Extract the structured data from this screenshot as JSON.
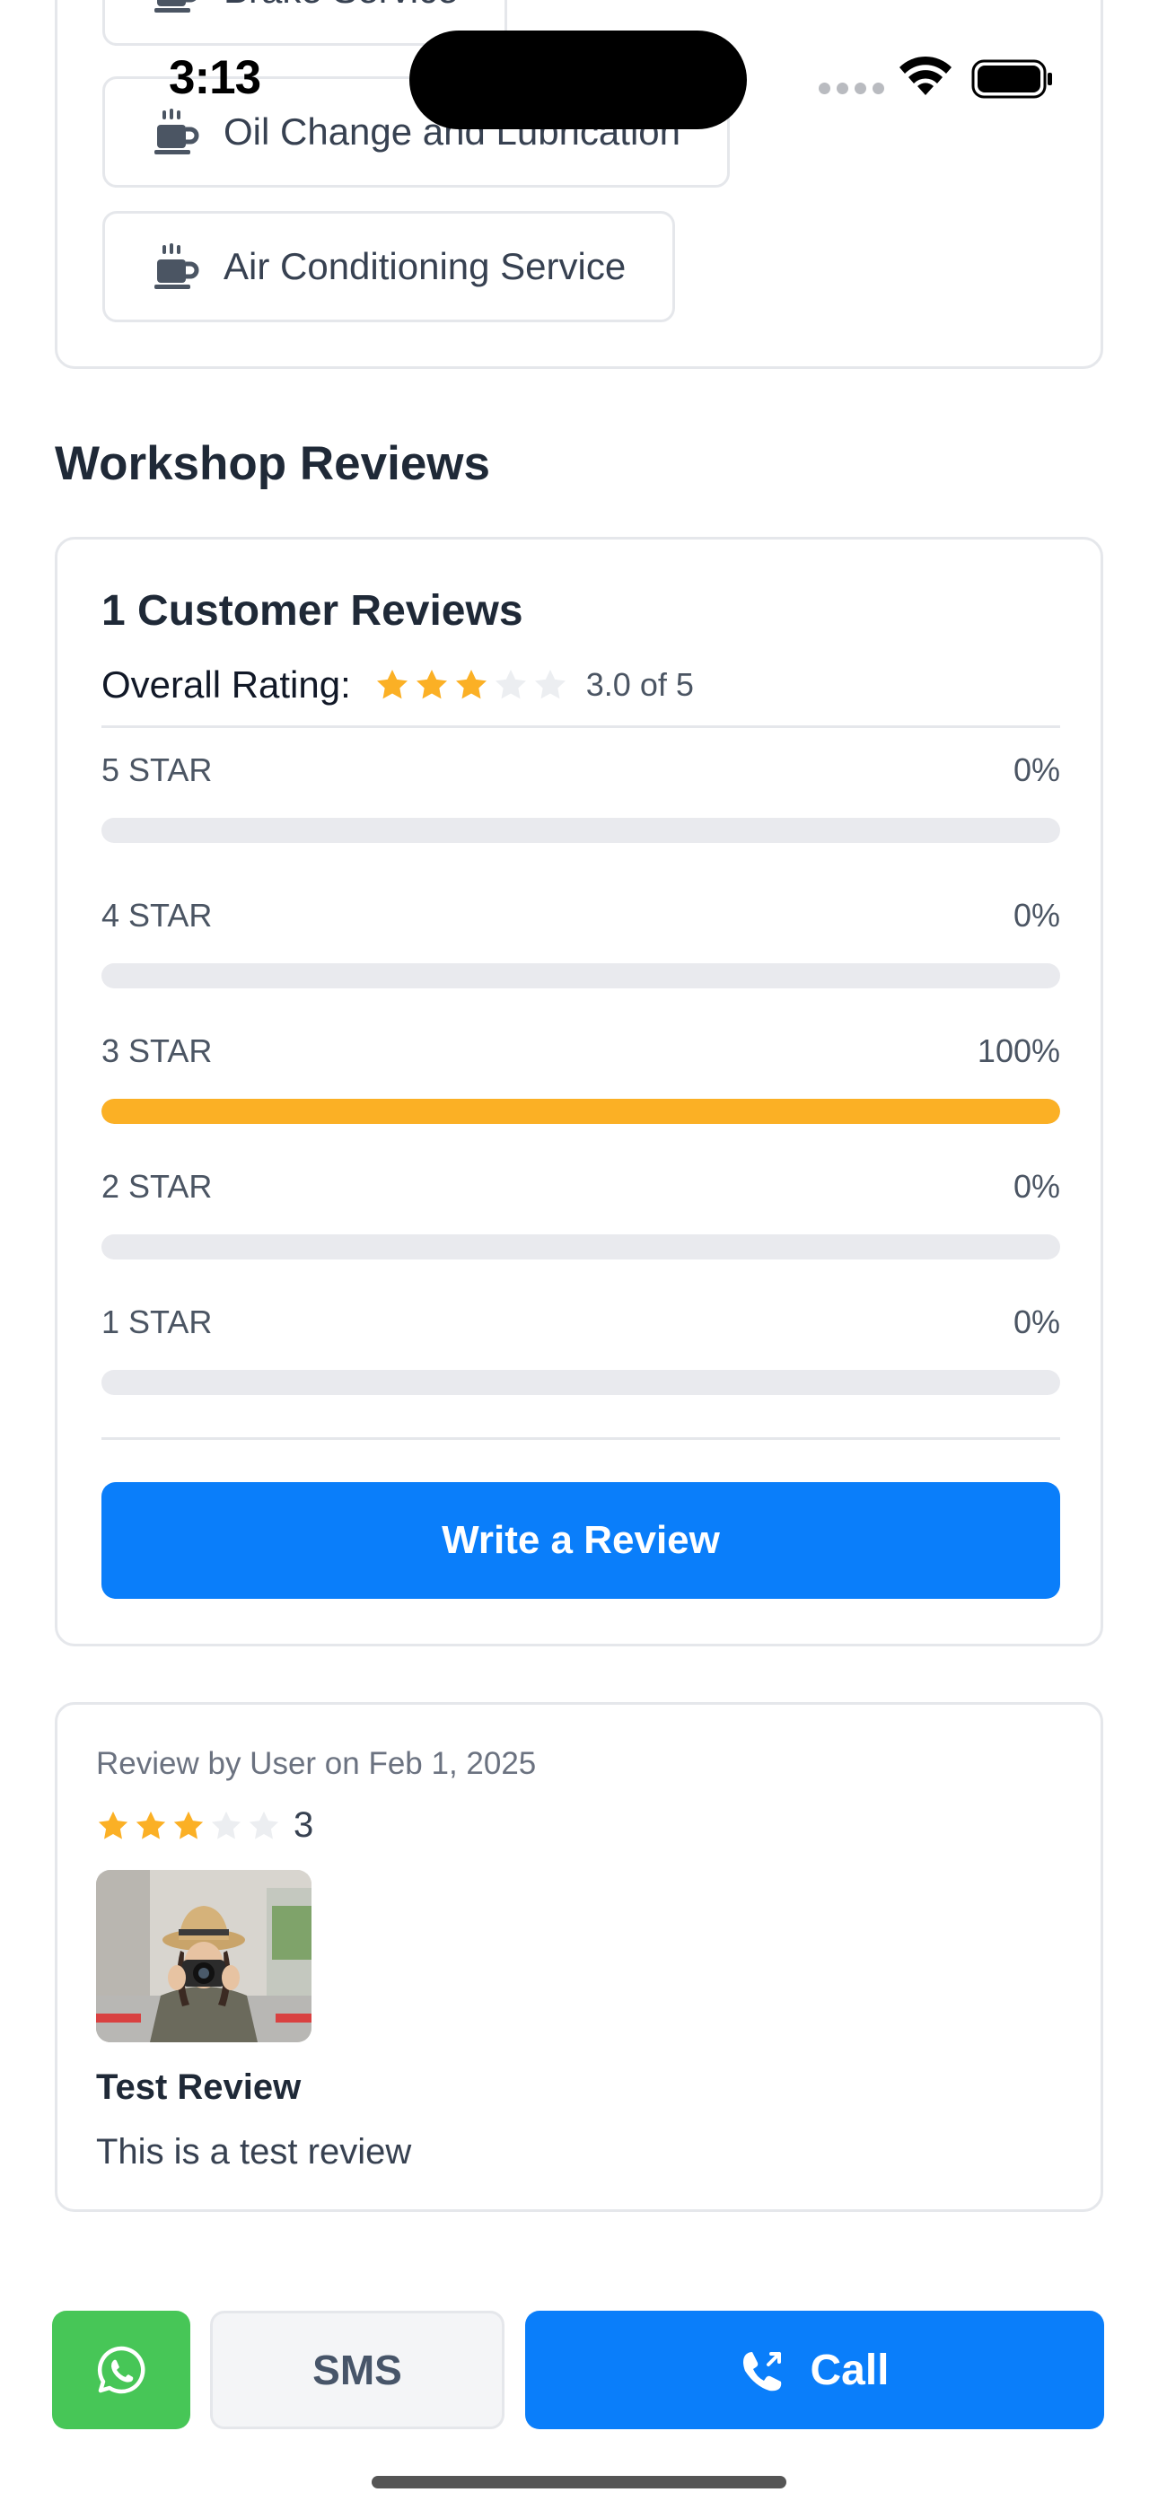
{
  "status_bar": {
    "time": "3:13"
  },
  "services": {
    "items": [
      {
        "label": "Brake Service",
        "icon": "coffee-cup-icon"
      },
      {
        "label": "Oil Change and Lubrication",
        "icon": "coffee-cup-icon"
      },
      {
        "label": "Air Conditioning Service",
        "icon": "coffee-cup-icon"
      }
    ]
  },
  "reviews_section": {
    "heading": "Workshop Reviews",
    "summary": {
      "title": "1 Customer Reviews",
      "overall_label": "Overall Rating:",
      "overall_stars": 3,
      "overall_value": "3.0 of 5",
      "distribution": [
        {
          "label": "5 STAR",
          "percent_text": "0%",
          "fraction": 0
        },
        {
          "label": "4 STAR",
          "percent_text": "0%",
          "fraction": 0
        },
        {
          "label": "3 STAR",
          "percent_text": "100%",
          "fraction": 1
        },
        {
          "label": "2 STAR",
          "percent_text": "0%",
          "fraction": 0
        },
        {
          "label": "1 STAR",
          "percent_text": "0%",
          "fraction": 0
        }
      ],
      "write_review_label": "Write a Review"
    },
    "review": {
      "meta": "Review by User on Feb 1, 2025",
      "stars": 3,
      "score": "3",
      "photo": "photographer-with-camera",
      "title": "Test Review",
      "body": "This is a test review"
    }
  },
  "actions": {
    "whatsapp_icon": "whatsapp-icon",
    "sms_label": "SMS",
    "call_label": "Call",
    "call_icon": "phone-call-icon"
  },
  "colors": {
    "primary": "#0a7efa",
    "star_filled": "#fbb025",
    "star_empty": "#eceef1",
    "whatsapp_green": "#47c657"
  }
}
